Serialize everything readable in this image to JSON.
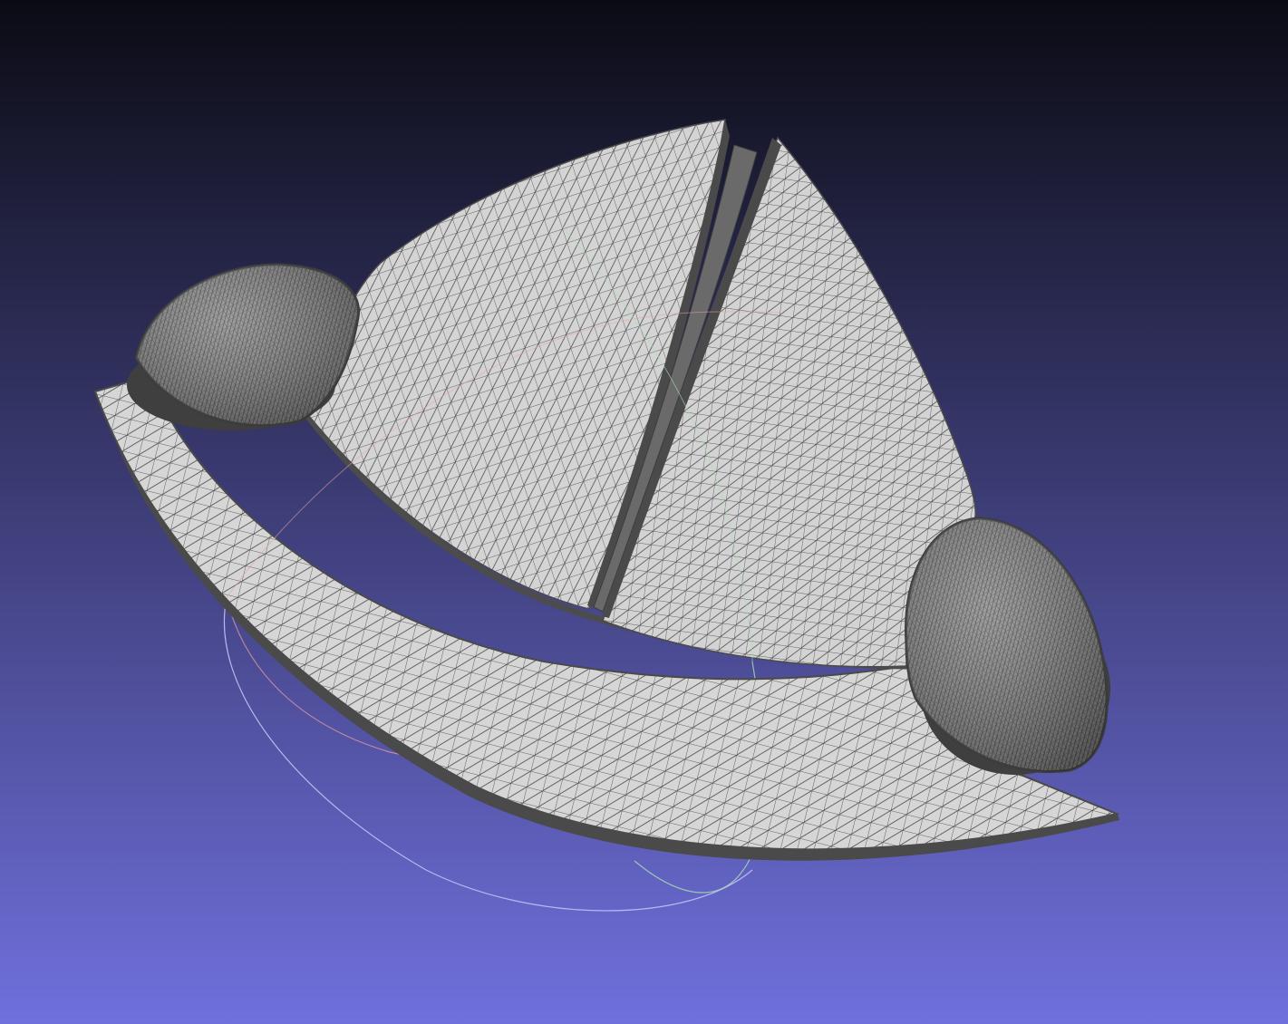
{
  "viewport": {
    "background_top": "#0b0b14",
    "background_bottom": "#7070dd"
  },
  "model": {
    "face_color": "#d2d2d2",
    "wire_color": "#3c3c3c",
    "boundary_color": "#4a4a4a",
    "rim_color": "#555555",
    "accent_red": "#e8a0a0",
    "accent_green": "#a8e0b0",
    "accent_blue": "#b8b8f0"
  }
}
